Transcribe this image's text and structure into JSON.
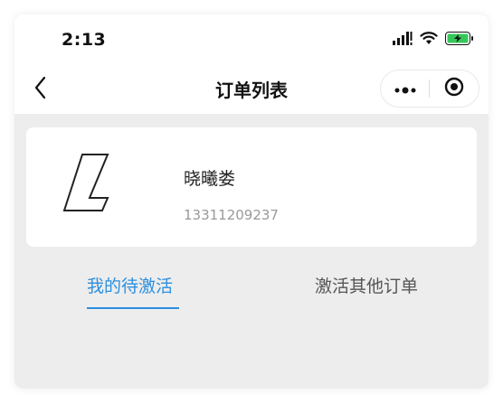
{
  "status_bar": {
    "time": "2:13",
    "icons": [
      "signal-icon",
      "wifi-icon",
      "battery-charging-icon"
    ]
  },
  "nav": {
    "title": "订单列表",
    "back_icon": "chevron-left-icon",
    "capsule": [
      "more-icon",
      "close-target-icon"
    ]
  },
  "user": {
    "name": "晓曦娄",
    "phone": "13311209237",
    "logo_icon": "brand-logo"
  },
  "tabs": [
    {
      "label": "我的待激活",
      "active": true
    },
    {
      "label": "激活其他订单",
      "active": false
    }
  ],
  "colors": {
    "accent": "#2b8fe0",
    "background": "#ededed",
    "card": "#ffffff",
    "battery": "#35c759"
  }
}
